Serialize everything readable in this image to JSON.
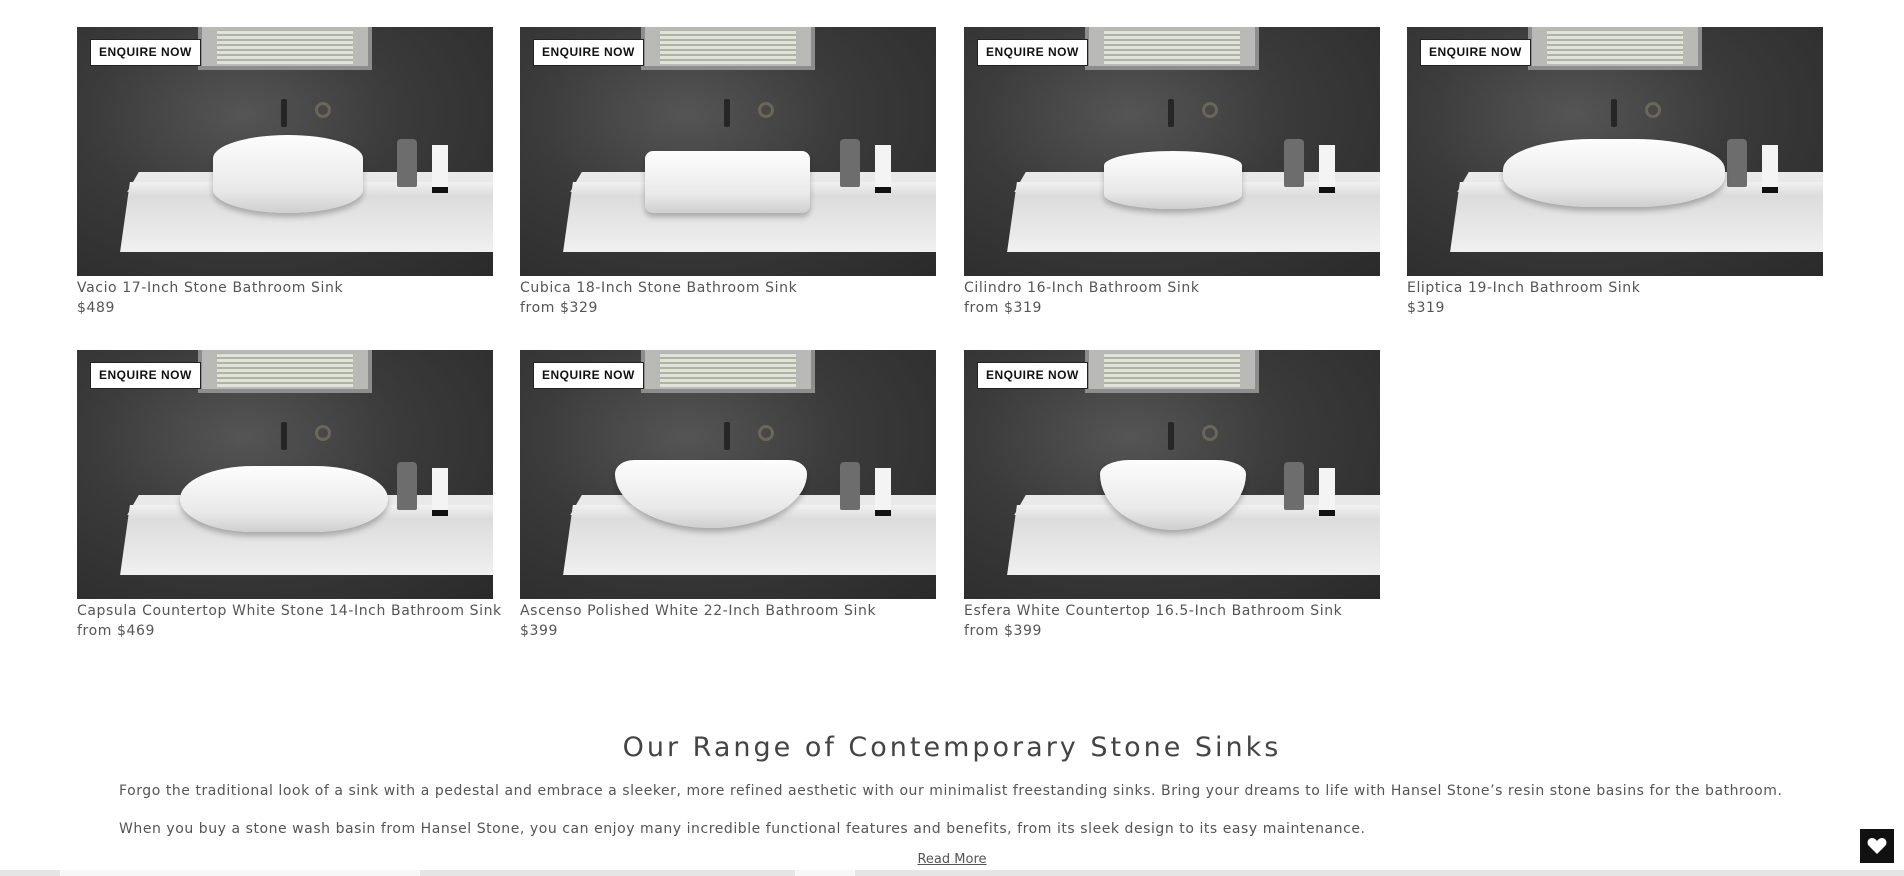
{
  "products": [
    {
      "name": "Vacio 17-Inch Stone Bathroom Sink",
      "price": "$489",
      "cta": "ENQUIRE NOW",
      "shape": "round"
    },
    {
      "name": "Cubica 18-Inch Stone Bathroom Sink",
      "price": "from $329",
      "cta": "ENQUIRE NOW",
      "shape": "square"
    },
    {
      "name": "Cilindro 16-Inch Bathroom Sink",
      "price": "from $319",
      "cta": "ENQUIRE NOW",
      "shape": "cyl"
    },
    {
      "name": "Eliptica 19-Inch Bathroom Sink",
      "price": "$319",
      "cta": "ENQUIRE NOW",
      "shape": "ellip"
    },
    {
      "name": "Capsula Countertop White Stone 14-Inch Bathroom Sink",
      "price": "from $469",
      "cta": "ENQUIRE NOW",
      "shape": "caps"
    },
    {
      "name": "Ascenso Polished White 22-Inch Bathroom Sink",
      "price": "$399",
      "cta": "ENQUIRE NOW",
      "shape": "boat"
    },
    {
      "name": "Esfera White Countertop 16.5-Inch Bathroom Sink",
      "price": "from $399",
      "cta": "ENQUIRE NOW",
      "shape": "bowl"
    }
  ],
  "section": {
    "title": "Our Range of Contemporary Stone Sinks",
    "paragraph1": "Forgo the traditional look of a sink with a pedestal and embrace a sleeker, more refined aesthetic with our minimalist freestanding sinks. Bring your dreams to life with Hansel Stone’s resin stone basins for the bathroom.",
    "paragraph2": "When you buy a stone wash basin from Hansel Stone, you can enjoy many incredible functional features and benefits, from its sleek design to its easy maintenance.",
    "read_more": "Read More"
  },
  "wishlist": {
    "icon": "heart-icon"
  }
}
